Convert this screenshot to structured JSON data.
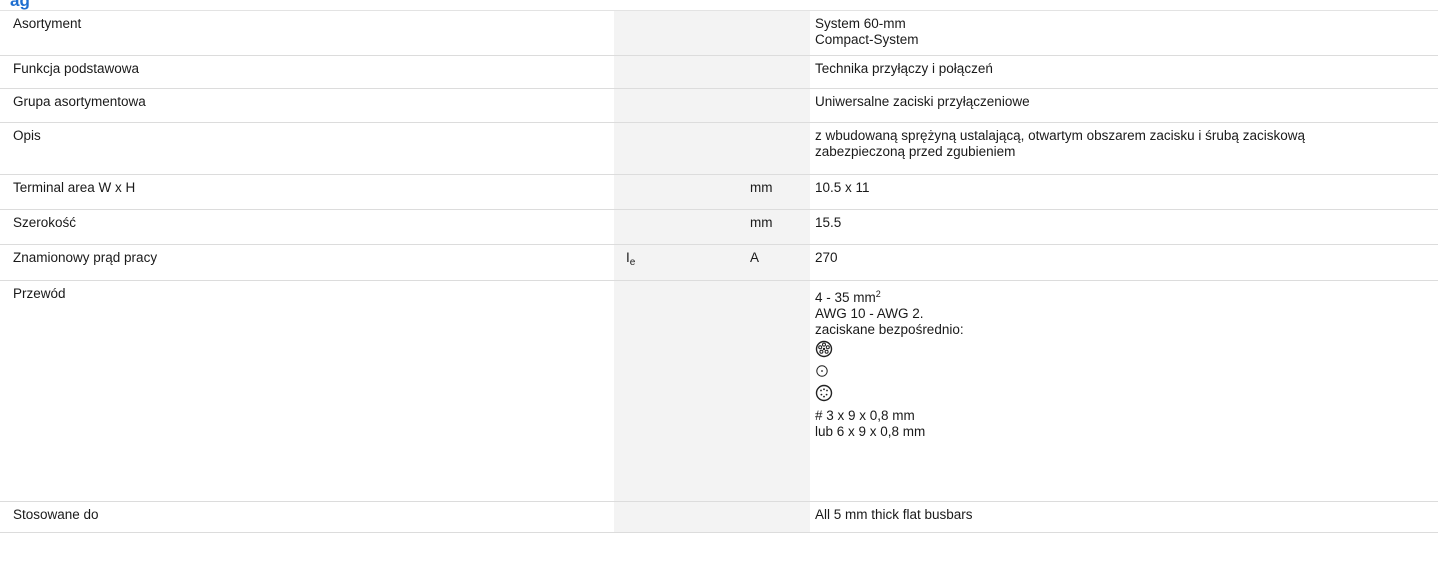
{
  "header": {
    "title_fragment": "ag"
  },
  "rows": [
    {
      "label": "Asortyment",
      "symbol": "",
      "symbol_sub": "",
      "unit": "",
      "lines": [
        "System 60-mm",
        "Compact-System"
      ]
    },
    {
      "label": "Funkcja podstawowa",
      "symbol": "",
      "symbol_sub": "",
      "unit": "",
      "lines": [
        "Technika przyłączy i połączeń"
      ]
    },
    {
      "label": "Grupa asortymentowa",
      "symbol": "",
      "symbol_sub": "",
      "unit": "",
      "lines": [
        "Uniwersalne zaciski przyłączeniowe"
      ]
    },
    {
      "label": "Opis",
      "symbol": "",
      "symbol_sub": "",
      "unit": "",
      "lines": [
        "z wbudowaną sprężyną ustalającą, otwartym obszarem zacisku i śrubą zaciskową",
        "zabezpieczoną przed zgubieniem"
      ]
    },
    {
      "label": "Terminal area W x H",
      "symbol": "",
      "symbol_sub": "",
      "unit": "mm",
      "lines": [
        "10.5 x 11"
      ]
    },
    {
      "label": "Szerokość",
      "symbol": "",
      "symbol_sub": "",
      "unit": "mm",
      "lines": [
        "15.5"
      ]
    },
    {
      "label": "Znamionowy prąd pracy",
      "symbol": "I",
      "symbol_sub": "e",
      "unit": "A",
      "lines": [
        "270"
      ]
    },
    {
      "label": "Przewód",
      "symbol": "",
      "symbol_sub": "",
      "unit": "",
      "conductor": {
        "range_value": "4 - 35 mm",
        "range_sup": "2",
        "awg": "AWG 10 - AWG 2.",
        "crimped": "zaciskane bezpośrednio:",
        "icons": [
          "stranded-conductor-icon",
          "solid-conductor-icon",
          "flexible-conductor-icon"
        ],
        "flat_1": "# 3 x 9 x 0,8 mm",
        "flat_2": "lub 6 x 9 x 0,8 mm"
      }
    },
    {
      "label": "Stosowane do",
      "symbol": "",
      "symbol_sub": "",
      "unit": "",
      "lines": [
        "All 5 mm thick flat busbars"
      ]
    }
  ]
}
